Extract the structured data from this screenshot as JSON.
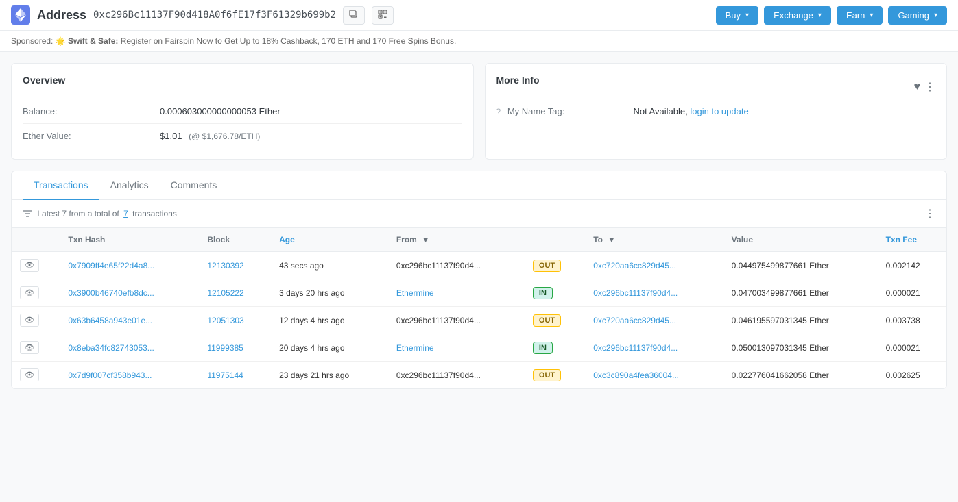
{
  "header": {
    "icon_alt": "ethereum-icon",
    "prefix": "Address",
    "address": "0xc296Bc11137F90d418A0f6fE17f3F61329b699b2",
    "copy_tooltip": "Copy",
    "qr_tooltip": "QR Code",
    "nav": [
      {
        "id": "buy",
        "label": "Buy",
        "class": "nav-btn-buy"
      },
      {
        "id": "exchange",
        "label": "Exchange",
        "class": "nav-btn-exchange"
      },
      {
        "id": "earn",
        "label": "Earn",
        "class": "nav-btn-earn"
      },
      {
        "id": "gaming",
        "label": "Gaming",
        "class": "nav-btn-gaming"
      }
    ]
  },
  "sponsored": {
    "label": "Sponsored:",
    "emoji": "🌟",
    "brand": "Swift & Safe:",
    "text": "Register on Fairspin Now to Get Up to 18% Cashback, 170 ETH and 170 Free Spins Bonus."
  },
  "overview": {
    "title": "Overview",
    "rows": [
      {
        "label": "Balance:",
        "value": "0.000603000000000053 Ether"
      },
      {
        "label": "Ether Value:",
        "value": "$1.01",
        "secondary": "(@ $1,676.78/ETH)"
      }
    ]
  },
  "more_info": {
    "title": "More Info",
    "name_tag_label": "My Name Tag:",
    "name_tag_value": "Not Available,",
    "name_tag_link": "login to update",
    "help_tooltip": "?"
  },
  "tabs": [
    {
      "id": "transactions",
      "label": "Transactions",
      "active": true
    },
    {
      "id": "analytics",
      "label": "Analytics",
      "active": false
    },
    {
      "id": "comments",
      "label": "Comments",
      "active": false
    }
  ],
  "transactions_info": {
    "latest": "Latest 7 from a total of",
    "count": "7",
    "suffix": "transactions"
  },
  "table": {
    "columns": [
      {
        "id": "eye",
        "label": ""
      },
      {
        "id": "txn_hash",
        "label": "Txn Hash"
      },
      {
        "id": "block",
        "label": "Block"
      },
      {
        "id": "age",
        "label": "Age",
        "sortable": true
      },
      {
        "id": "from",
        "label": "From"
      },
      {
        "id": "direction",
        "label": ""
      },
      {
        "id": "to",
        "label": "To"
      },
      {
        "id": "value",
        "label": "Value"
      },
      {
        "id": "txn_fee",
        "label": "Txn Fee",
        "sortable": true
      }
    ],
    "rows": [
      {
        "txn_hash": "0x7909ff4e65f22d4a8...",
        "block": "12130392",
        "age": "43 secs ago",
        "from": "0xc296bc11137f90d4...",
        "direction": "OUT",
        "to": "0xc720aa6cc829d45...",
        "value": "0.044975499877661 Ether",
        "txn_fee": "0.002142"
      },
      {
        "txn_hash": "0x3900b46740efb8dc...",
        "block": "12105222",
        "age": "3 days 20 hrs ago",
        "from": "Ethermine",
        "from_is_link": true,
        "direction": "IN",
        "to": "0xc296bc11137f90d4...",
        "value": "0.047003499877661 Ether",
        "txn_fee": "0.000021"
      },
      {
        "txn_hash": "0x63b6458a943e01e...",
        "block": "12051303",
        "age": "12 days 4 hrs ago",
        "from": "0xc296bc11137f90d4...",
        "direction": "OUT",
        "to": "0xc720aa6cc829d45...",
        "value": "0.046195597031345 Ether",
        "txn_fee": "0.003738"
      },
      {
        "txn_hash": "0x8eba34fc82743053...",
        "block": "11999385",
        "age": "20 days 4 hrs ago",
        "from": "Ethermine",
        "from_is_link": true,
        "direction": "IN",
        "to": "0xc296bc11137f90d4...",
        "value": "0.050013097031345 Ether",
        "txn_fee": "0.000021"
      },
      {
        "txn_hash": "0x7d9f007cf358b943...",
        "block": "11975144",
        "age": "23 days 21 hrs ago",
        "from": "0xc296bc11137f90d4...",
        "direction": "OUT",
        "to": "0xc3c890a4fea36004...",
        "to_is_link": true,
        "value": "0.022776041662058 Ether",
        "txn_fee": "0.002625"
      }
    ]
  }
}
